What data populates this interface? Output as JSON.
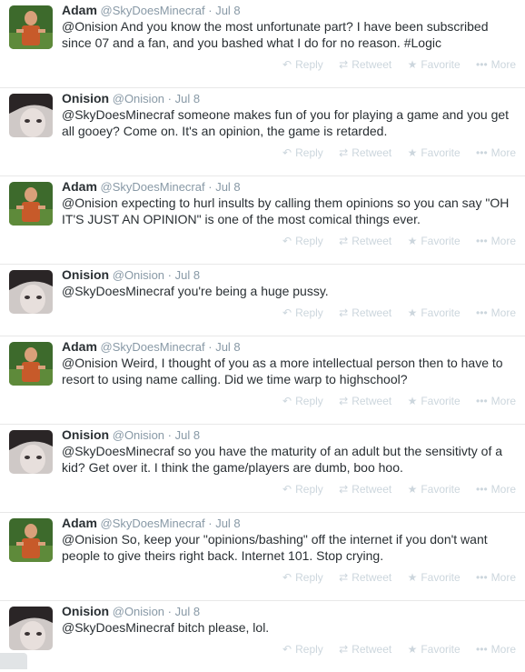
{
  "actions": {
    "reply": "Reply",
    "retweet": "Retweet",
    "favorite": "Favorite",
    "more": "More",
    "reply_icon": "reply-icon",
    "retweet_icon": "retweet-icon",
    "favorite_icon": "star-icon",
    "more_icon": "more-dots-icon"
  },
  "tweets": [
    {
      "name": "Adam",
      "handle": "@SkyDoesMinecraf",
      "dot": "·",
      "time": "Jul 8",
      "text": "@Onision And you know the most unfortunate part? I have been subscribed since 07 and a fan, and you bashed what I do for no reason. #Logic"
    },
    {
      "name": "Onision",
      "handle": "@Onision",
      "dot": "·",
      "time": "Jul 8",
      "text": "@SkyDoesMinecraf someone makes fun of you for playing a game and you get all gooey? Come on. It's an opinion, the game is retarded."
    },
    {
      "name": "Adam",
      "handle": "@SkyDoesMinecraf",
      "dot": "·",
      "time": "Jul 8",
      "text": "@Onision expecting to hurl insults by calling them opinions so you can say \"OH IT'S JUST AN OPINION\" is one of the most comical things ever."
    },
    {
      "name": "Onision",
      "handle": "@Onision",
      "dot": "·",
      "time": "Jul 8",
      "text": "@SkyDoesMinecraf you're being a huge pussy."
    },
    {
      "name": "Adam",
      "handle": "@SkyDoesMinecraf",
      "dot": "·",
      "time": "Jul 8",
      "text": "@Onision Weird, I thought of you as a more intellectual person then to have to resort to using name calling. Did we time warp to highschool?"
    },
    {
      "name": "Onision",
      "handle": "@Onision",
      "dot": "·",
      "time": "Jul 8",
      "text": "@SkyDoesMinecraf so you have the maturity of an adult but the sensitivty of a kid? Get over it. I think the game/players are dumb, boo hoo."
    },
    {
      "name": "Adam",
      "handle": "@SkyDoesMinecraf",
      "dot": "·",
      "time": "Jul 8",
      "text": "@Onision So, keep your \"opinions/bashing\" off the internet if you don't want people to give theirs right back. Internet 101. Stop crying."
    },
    {
      "name": "Onision",
      "handle": "@Onision",
      "dot": "·",
      "time": "Jul 8",
      "text": "@SkyDoesMinecraf bitch please, lol."
    }
  ]
}
